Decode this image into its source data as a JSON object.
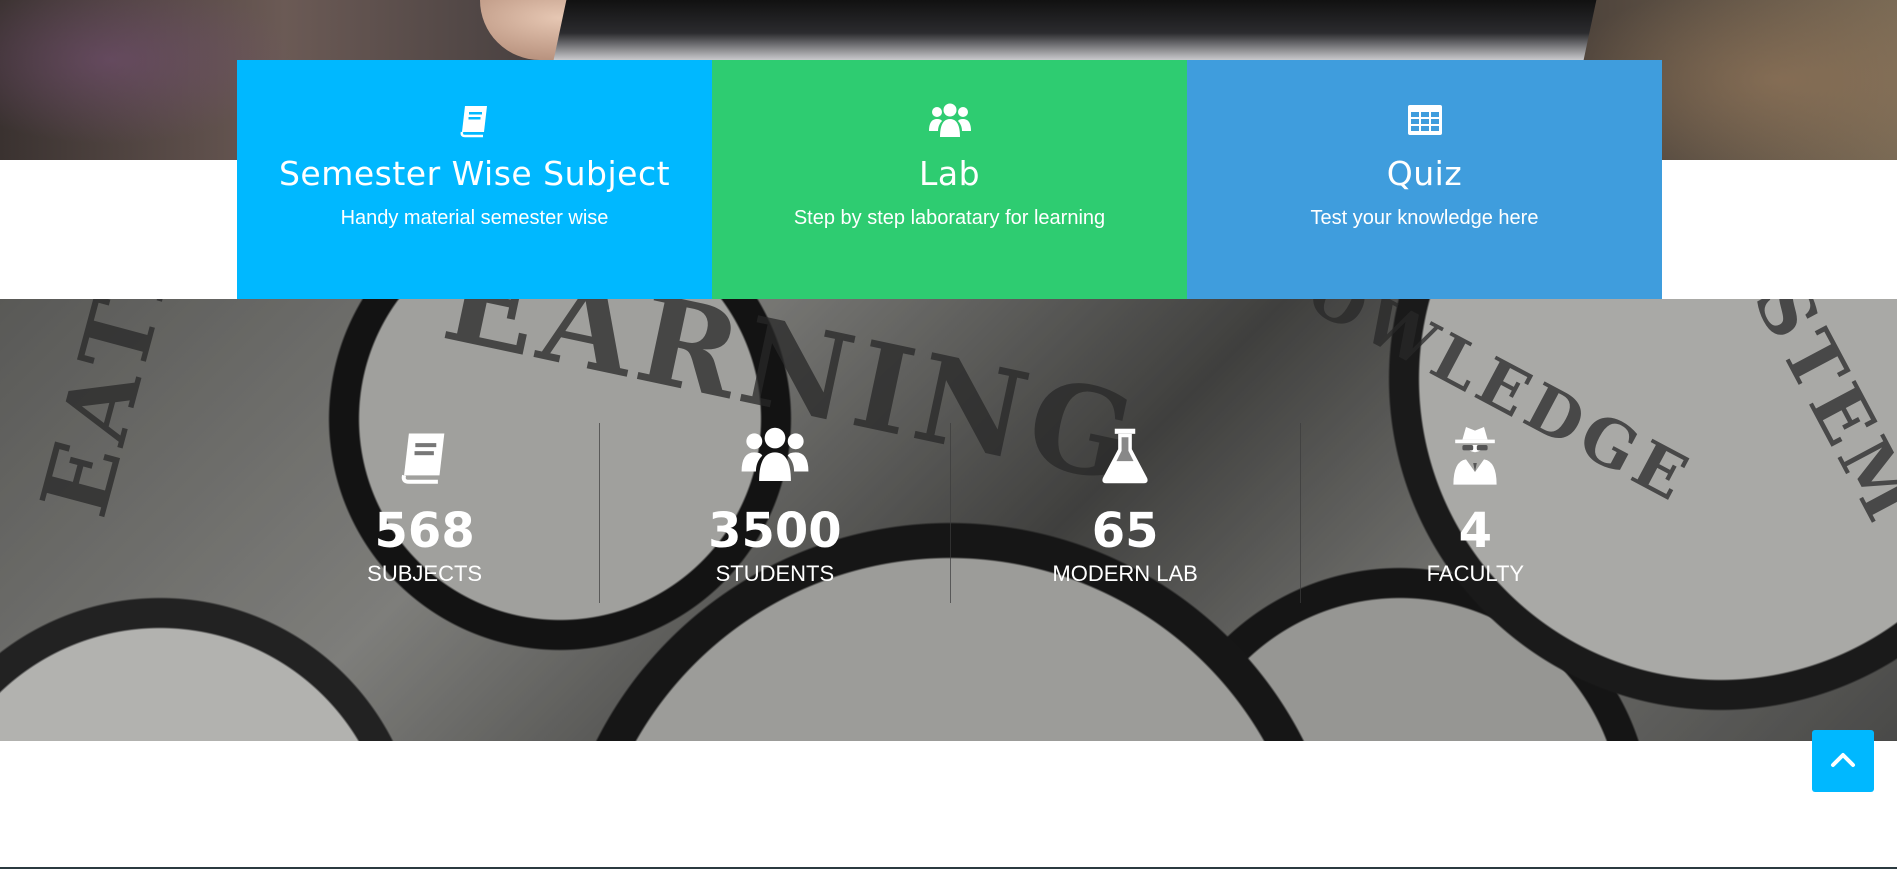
{
  "features": [
    {
      "icon": "book-icon",
      "title": "Semester Wise Subject",
      "subtitle": "Handy material semester wise",
      "color": "#00b8ff"
    },
    {
      "icon": "users-icon",
      "title": "Lab",
      "subtitle": "Step by step laboratary for learning",
      "color": "#2ecc71"
    },
    {
      "icon": "table-icon",
      "title": "Quiz",
      "subtitle": "Test your knowledge here",
      "color": "#3f9ddd"
    }
  ],
  "stats": [
    {
      "icon": "book-icon",
      "value": "568",
      "label": "SUBJECTS"
    },
    {
      "icon": "users-icon",
      "value": "3500",
      "label": "STUDENTS"
    },
    {
      "icon": "flask-icon",
      "value": "65",
      "label": "MODERN LAB"
    },
    {
      "icon": "user-secret-icon",
      "value": "4",
      "label": "FACULTY"
    }
  ],
  "background_words": [
    "EATIVITY",
    "EARNING",
    "KNOWLEDGE",
    "SYSTEM"
  ],
  "back_to_top": {
    "icon": "chevron-up-icon",
    "color": "#00b8ff"
  }
}
